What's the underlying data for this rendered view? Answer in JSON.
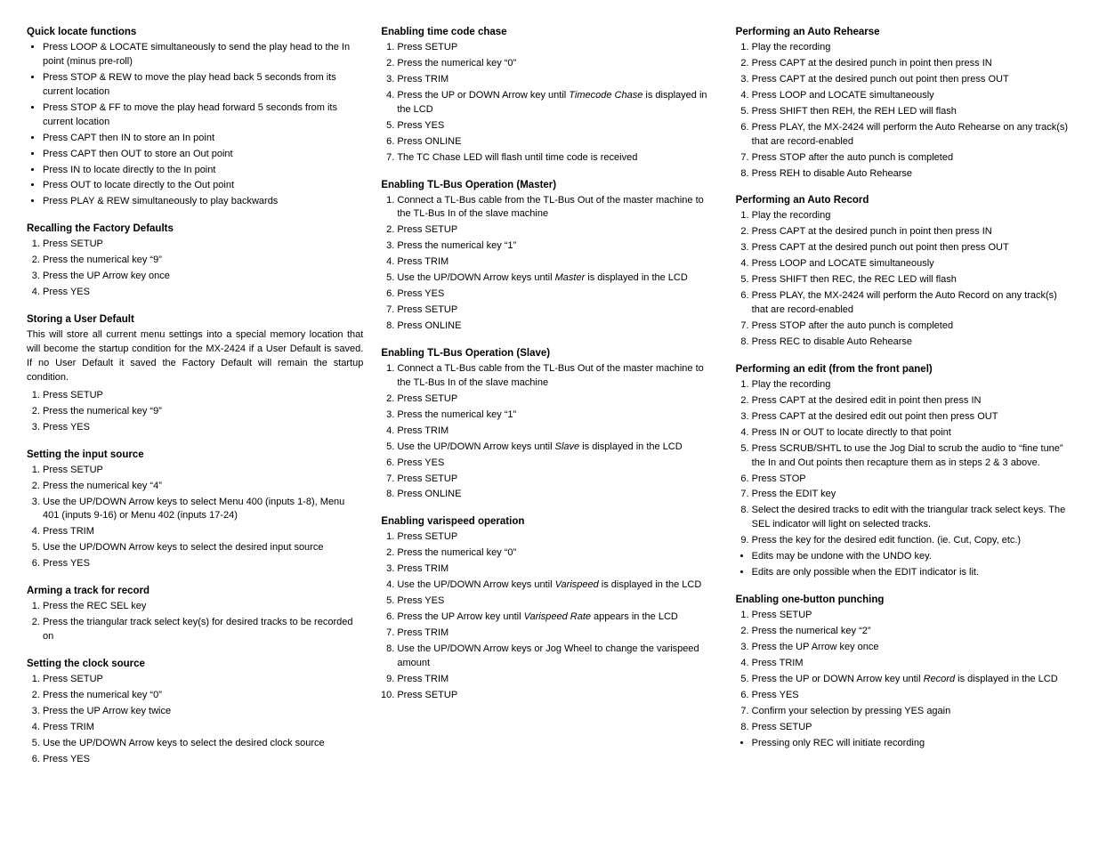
{
  "col1": {
    "sections": [
      {
        "id": "quick-locate",
        "title": "Quick locate functions",
        "type": "bullets",
        "items": [
          "Press LOOP & LOCATE simultaneously to send the play head to the In point (minus pre-roll)",
          "Press STOP & REW to move the play head back 5 seconds from its current location",
          "Press STOP & FF to move the play head forward 5 seconds from its current location",
          "Press CAPT then IN to store an In point",
          "Press CAPT then OUT to store an Out point",
          "Press IN to locate directly to the In point",
          "Press OUT to locate directly to the Out point",
          "Press PLAY & REW simultaneously to play backwards"
        ]
      },
      {
        "id": "factory-defaults",
        "title": "Recalling the Factory Defaults",
        "type": "numbered",
        "items": [
          "Press SETUP",
          "Press the numerical key \"9\"",
          "Press the UP Arrow key once",
          "Press YES"
        ]
      },
      {
        "id": "user-default",
        "title": "Storing a User Default",
        "type": "paragraph+numbered",
        "paragraph": "This will store all current menu settings into a special memory location that will become the startup condition for the MX-2424 if a User Default is saved.  If no User Default it saved the Factory Default will remain the startup condition.",
        "items": [
          "Press SETUP",
          "Press the numerical key \"9\"",
          "Press YES"
        ]
      },
      {
        "id": "input-source",
        "title": "Setting the input source",
        "type": "numbered",
        "items": [
          "Press SETUP",
          "Press the numerical key \"4\"",
          "Use the UP/DOWN Arrow keys to select Menu 400 (inputs 1-8), Menu 401 (inputs 9-16) or Menu 402 (inputs 17-24)",
          "Press TRIM",
          "Use the UP/DOWN Arrow keys to select the desired input source",
          "Press YES"
        ]
      },
      {
        "id": "arm-track",
        "title": "Arming a track for record",
        "type": "numbered",
        "items": [
          "Press the REC SEL key",
          "Press the triangular track select key(s) for desired tracks to be recorded on"
        ]
      },
      {
        "id": "clock-source",
        "title": "Setting the clock source",
        "type": "numbered",
        "items": [
          "Press SETUP",
          "Press the numerical key \"0\"",
          "Press the UP Arrow key twice",
          "Press TRIM",
          "Use the UP/DOWN Arrow keys to select the desired clock source",
          "Press YES"
        ]
      }
    ]
  },
  "col2": {
    "sections": [
      {
        "id": "timecode-chase",
        "title": "Enabling time code chase",
        "type": "numbered",
        "items": [
          "Press SETUP",
          "Press the numerical key \"0\"",
          "Press TRIM",
          "Press the UP or DOWN Arrow key until <i>Timecode Chase</i> is displayed in the LCD",
          "Press YES",
          "Press ONLINE",
          "The TC Chase LED will flash until time code is received"
        ]
      },
      {
        "id": "tlbus-master",
        "title": "Enabling TL-Bus Operation (Master)",
        "type": "numbered",
        "items": [
          "Connect a TL-Bus cable from the TL-Bus Out of the master machine to the TL-Bus In of the slave machine",
          "Press SETUP",
          "Press the numerical key \"1\"",
          "Press TRIM",
          "Use the UP/DOWN Arrow keys until <i>Master</i> is displayed in the LCD",
          "Press YES",
          "Press SETUP",
          "Press ONLINE"
        ]
      },
      {
        "id": "tlbus-slave",
        "title": "Enabling TL-Bus Operation (Slave)",
        "type": "numbered",
        "items": [
          "Connect a TL-Bus cable from the TL-Bus Out of the master machine to the TL-Bus In of the slave machine",
          "Press SETUP",
          "Press the numerical key \"1\"",
          "Press TRIM",
          "Use the UP/DOWN Arrow keys until <i>Slave</i> is displayed in the LCD",
          "Press YES",
          "Press SETUP",
          "Press ONLINE"
        ]
      },
      {
        "id": "varispeed",
        "title": "Enabling varispeed operation",
        "type": "numbered",
        "items": [
          "Press SETUP",
          "Press the numerical key \"0\"",
          "Press TRIM",
          "Use the UP/DOWN Arrow keys until <i>Varispeed</i> is displayed in the LCD",
          "Press YES",
          "Press the UP Arrow key until <i>Varispeed Rate</i> appears in the LCD",
          "Press TRIM",
          "Use the UP/DOWN Arrow keys or Jog Wheel to change the varispeed amount",
          "Press TRIM",
          "Press SETUP"
        ]
      }
    ]
  },
  "col3": {
    "sections": [
      {
        "id": "auto-rehearse",
        "title": "Performing an Auto Rehearse",
        "type": "numbered",
        "items": [
          "Play the recording",
          "Press CAPT at the desired punch in point then press IN",
          "Press CAPT at the desired punch out point then press OUT",
          "Press LOOP and LOCATE simultaneously",
          "Press SHIFT then REH, the REH LED will flash",
          "Press PLAY, the MX-2424 will perform the Auto Rehearse on any track(s) that are record-enabled",
          "Press STOP after the auto punch is completed",
          "Press REH to disable Auto Rehearse"
        ]
      },
      {
        "id": "auto-record",
        "title": "Performing an Auto Record",
        "type": "numbered",
        "items": [
          "Play the recording",
          "Press CAPT at the desired punch in point then press IN",
          "Press CAPT at the desired punch out point then press OUT",
          "Press LOOP and LOCATE simultaneously",
          "Press SHIFT then REC, the REC LED will flash",
          "Press PLAY, the MX-2424 will perform the Auto Record on any track(s) that are record-enabled",
          "Press STOP after the auto punch is completed",
          "Press REC to disable Auto Rehearse"
        ]
      },
      {
        "id": "edit-front-panel",
        "title": "Performing an edit (from the front panel)",
        "type": "numbered+bullets",
        "numbered": [
          "Play the recording",
          "Press CAPT at the desired edit in point then press IN",
          "Press CAPT at the desired edit out point then press OUT",
          "Press IN or OUT to locate directly to that point",
          "Press SCRUB/SHTL to use the Jog Dial to scrub the audio to \"fine tune\" the In and Out points then recapture them as in steps 2 & 3 above.",
          "Press STOP",
          "Press the EDIT key",
          "Select the desired tracks to edit with the triangular track select keys.  The SEL indicator will light on selected tracks.",
          "Press the key for the desired edit function. (ie. Cut, Copy, etc.)"
        ],
        "bullets": [
          "Edits may be undone with the UNDO key.",
          "Edits are only possible when the EDIT indicator is lit."
        ]
      },
      {
        "id": "one-button-punch",
        "title": "Enabling one-button punching",
        "type": "numbered+bullets",
        "numbered": [
          "Press SETUP",
          "Press the numerical key \"2\"",
          "Press the UP Arrow key once",
          "Press TRIM",
          "Press the UP or DOWN Arrow key until <i>Record</i> is displayed in the LCD",
          "Press YES",
          "Confirm your selection by pressing YES again",
          "Press SETUP"
        ],
        "bullets": [
          "Pressing only REC will initiate recording"
        ]
      }
    ]
  }
}
